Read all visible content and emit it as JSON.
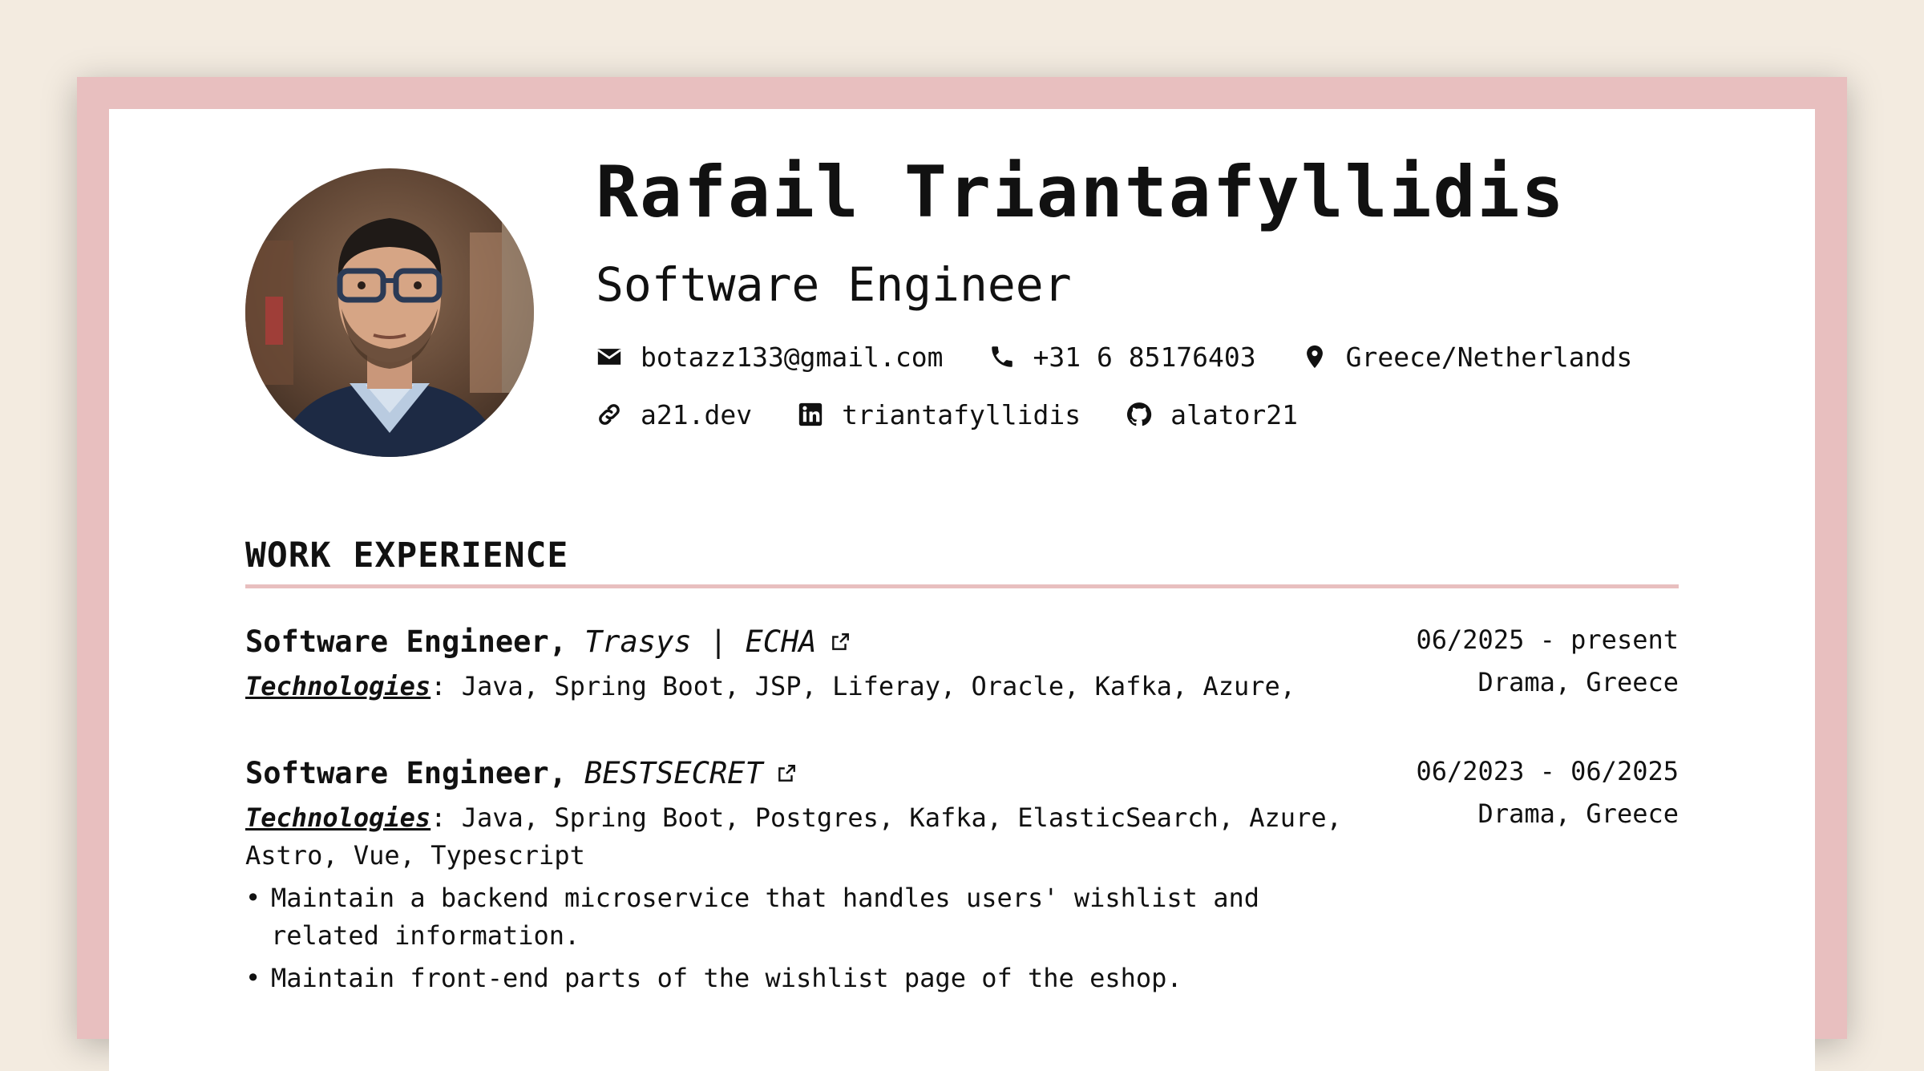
{
  "header": {
    "name": "Rafail Triantafyllidis",
    "role": "Software Engineer",
    "contacts_row1": [
      {
        "icon": "mail-icon",
        "text": "botazz133@gmail.com"
      },
      {
        "icon": "phone-icon",
        "text": "+31 6 85176403"
      },
      {
        "icon": "location-icon",
        "text": "Greece/Netherlands"
      }
    ],
    "contacts_row2": [
      {
        "icon": "link-icon",
        "text": "a21.dev"
      },
      {
        "icon": "linkedin-icon",
        "text": "triantafyllidis"
      },
      {
        "icon": "github-icon",
        "text": "alator21"
      }
    ]
  },
  "work": {
    "title": "WORK EXPERIENCE",
    "jobs": [
      {
        "position": "Software Engineer,",
        "company": "Trasys | ECHA",
        "dates": "06/2025 - present",
        "location": "Drama, Greece",
        "tech_label": "Technologies",
        "tech_list": ": Java, Spring Boot, JSP, Liferay, Oracle, Kafka, Azure,",
        "bullets": []
      },
      {
        "position": "Software Engineer,",
        "company": "BESTSECRET",
        "dates": "06/2023 - 06/2025",
        "location": "Drama, Greece",
        "tech_label": "Technologies",
        "tech_list": ": Java, Spring Boot, Postgres, Kafka, ElasticSearch, Azure, Astro, Vue, Typescript",
        "bullets": [
          "Maintain a backend microservice that handles users' wishlist and related information.",
          "Maintain front-end parts of the wishlist page of the eshop."
        ]
      }
    ]
  },
  "colors": {
    "accent": "#e8bfbf",
    "background": "#f3ebe0"
  }
}
